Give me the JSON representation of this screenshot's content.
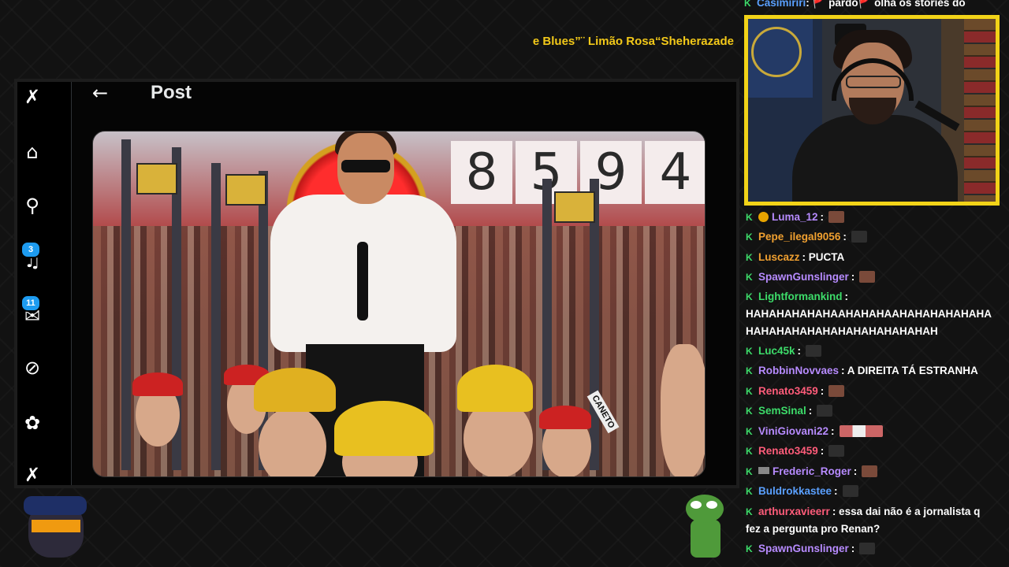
{
  "ticker": {
    "text": "e Blues”¨ Limão Rosa“Sheherazade"
  },
  "browser": {
    "post_title": "Post",
    "nav_badges": {
      "notifications": "3",
      "messages": "11"
    },
    "icons": [
      "x-logo-icon",
      "home-icon",
      "search-icon",
      "notifications-icon",
      "messages-icon",
      "grok-icon",
      "communities-icon",
      "premium-icon"
    ]
  },
  "media": {
    "counter_digits": [
      "8",
      "5",
      "9",
      "4"
    ],
    "tag_text": "CANETO"
  },
  "chat": {
    "top_line": {
      "user": "Casimiriri",
      "text": ": 🚩 pardo🚩 olha os stories do"
    },
    "messages": [
      {
        "user": "Luma_12",
        "color": "#b78bff",
        "text": ":",
        "emote": "emote",
        "coin": true
      },
      {
        "user": "Pepe_ilegal9056",
        "color": "#f0a030",
        "text": ":",
        "emote": "dark"
      },
      {
        "user": "Luscazz",
        "color": "#f0a030",
        "text": ": PUCTA"
      },
      {
        "user": "SpawnGunslinger",
        "color": "#b78bff",
        "text": ":",
        "emote": "emote"
      },
      {
        "user": "Lightformankind",
        "color": "#3ddc6a",
        "text": ":"
      },
      {
        "user": "",
        "color": "#ffffff",
        "text": "HAHAHAHAHAHAAHAHAHAAHAHAHAHAHAHA"
      },
      {
        "user": "",
        "color": "#ffffff",
        "text": "HAHAHAHAHAHAHAHAHAHAHAHAH"
      },
      {
        "user": "Luc45k",
        "color": "#3ddc6a",
        "text": ":",
        "emote": "dark"
      },
      {
        "user": "RobbinNovvaes",
        "color": "#b78bff",
        "text": ": A DIREITA TÁ ESTRANHA"
      },
      {
        "user": "Renato3459",
        "color": "#ff5c7a",
        "text": ":",
        "emote": "emote"
      },
      {
        "user": "SemSinal",
        "color": "#3ddc6a",
        "text": ":",
        "emote": "dark"
      },
      {
        "user": "ViniGiovani22",
        "color": "#b78bff",
        "text": ":",
        "emote": "wide"
      },
      {
        "user": "Renato3459",
        "color": "#ff5c7a",
        "text": ":",
        "emote": "dark"
      },
      {
        "user": "Frederic_Roger",
        "color": "#b78bff",
        "text": ":",
        "emote": "emote",
        "crown": true
      },
      {
        "user": "Buldrokkastee",
        "color": "#5aa0ff",
        "text": ":",
        "emote": "dark"
      },
      {
        "user": "arthurxavieerr",
        "color": "#ff5c7a",
        "text": ": essa dai não é a jornalista q"
      },
      {
        "user": "",
        "color": "#ffffff",
        "text": "fez a pergunta pro Renan?"
      },
      {
        "user": "SpawnGunslinger",
        "color": "#b78bff",
        "text": ":",
        "emote": "dark"
      }
    ]
  },
  "colors": {
    "accent": "#f2d318",
    "link": "#1d9bf0"
  }
}
